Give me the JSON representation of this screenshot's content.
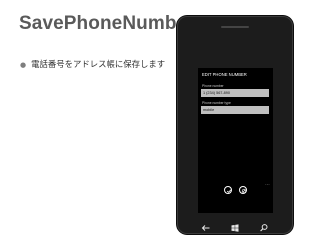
{
  "slide": {
    "title": "SavePhoneNumberTask",
    "bullet": "電話番号をアドレス帳に保存します"
  },
  "phone_screen": {
    "page_title": "EDIT PHONE NUMBER",
    "fields": [
      {
        "label": "Phone number",
        "value": "1 (234) 567-890"
      },
      {
        "label": "Phone number type",
        "value": "mobile"
      }
    ],
    "more_indicator": "...",
    "app_bar": [
      {
        "name": "save",
        "icon": "check-icon"
      },
      {
        "name": "cancel",
        "icon": "cancel-icon"
      }
    ]
  },
  "hardware_buttons": [
    {
      "name": "back",
      "icon": "back-arrow-icon"
    },
    {
      "name": "start",
      "icon": "windows-logo-icon"
    },
    {
      "name": "search",
      "icon": "search-icon"
    }
  ],
  "colors": {
    "title_text": "#5a5a5a",
    "phone_body": "#1c1c1c",
    "screen_bg": "#000000",
    "field_bg": "#bfbfbf"
  }
}
